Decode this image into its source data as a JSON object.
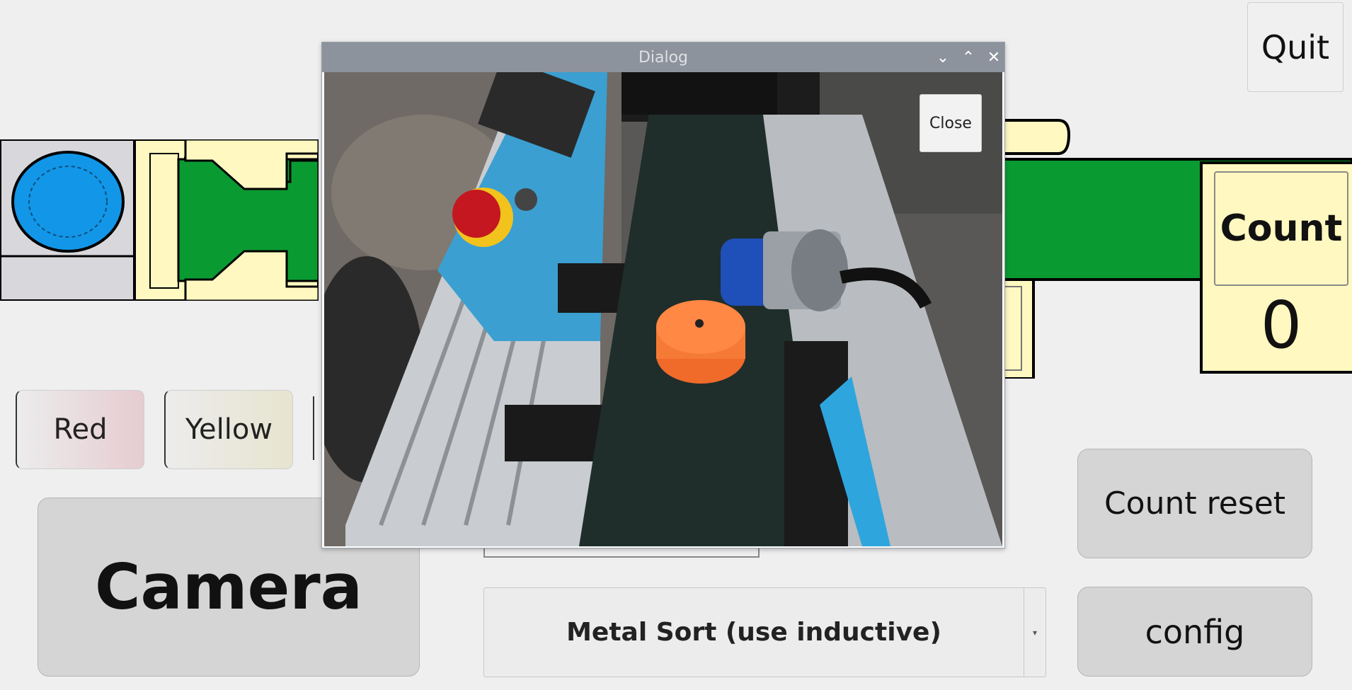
{
  "window": {
    "quit_label": "Quit"
  },
  "color_buttons": {
    "red_label": "Red",
    "yellow_label": "Yellow"
  },
  "camera_button_label": "Camera",
  "count": {
    "title": "Count",
    "value": "0",
    "reset_label": "Count reset"
  },
  "config_label": "config",
  "mode_select": {
    "selected": "Metal Sort (use inductive)"
  },
  "dialog": {
    "title": "Dialog",
    "close_label": "Close"
  },
  "icons": {
    "minimize": "chevron-down-icon",
    "maximize": "chevron-up-icon",
    "close": "close-icon",
    "select_arrow": "caret-down-icon"
  },
  "colors": {
    "belt_green": "#0a9a32",
    "panel_yellow": "#fff8c0",
    "sensor_blue": "#1296e8"
  }
}
